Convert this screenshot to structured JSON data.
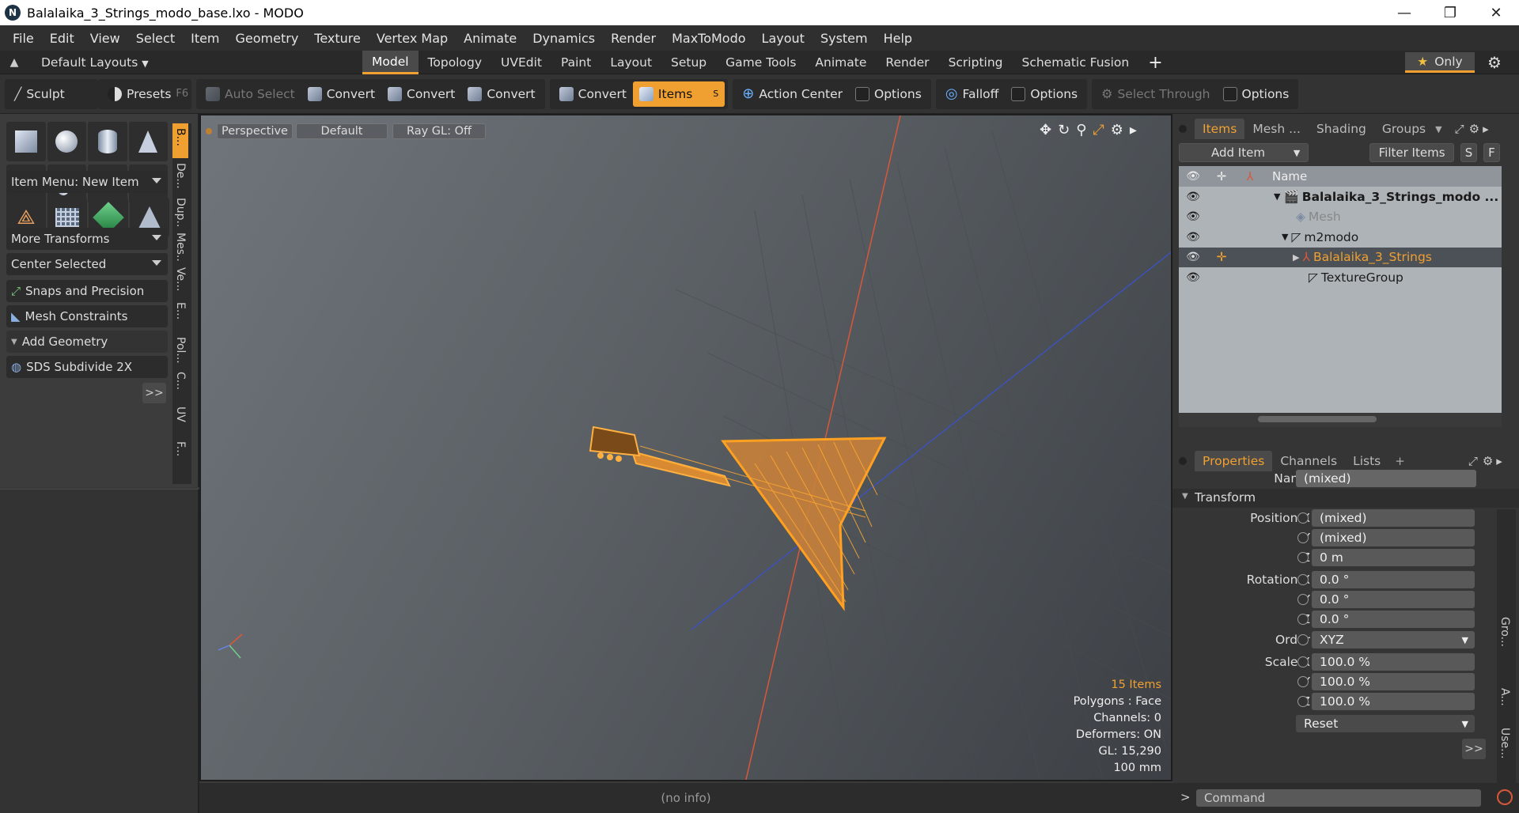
{
  "window": {
    "title": "Balalaika_3_Strings_modo_base.lxo - MODO",
    "logo": "N",
    "min": "—",
    "max": "❐",
    "close": "✕"
  },
  "menu": [
    "File",
    "Edit",
    "View",
    "Select",
    "Item",
    "Geometry",
    "Texture",
    "Vertex Map",
    "Animate",
    "Dynamics",
    "Render",
    "MaxToModo",
    "Layout",
    "System",
    "Help"
  ],
  "layoutbar": {
    "layouts_label": "Default Layouts",
    "tabs": [
      "Model",
      "Topology",
      "UVEdit",
      "Paint",
      "Layout",
      "Setup",
      "Game Tools",
      "Animate",
      "Render",
      "Scripting",
      "Schematic Fusion"
    ],
    "active_tab": "Model",
    "plus": "+",
    "only": "Only",
    "star": "★",
    "gear": "⚙"
  },
  "toolbar": {
    "sculpt": "Sculpt",
    "presets": "Presets",
    "presets_key": "F6",
    "auto_select": "Auto Select",
    "convert1": "Convert",
    "convert2": "Convert",
    "convert3": "Convert",
    "convert4": "Convert",
    "items": "Items",
    "items_key": "S",
    "action_center": "Action Center",
    "options1": "Options",
    "falloff": "Falloff",
    "options2": "Options",
    "select_through": "Select Through",
    "options3": "Options"
  },
  "leftpanel": {
    "item_menu": "Item Menu: New Item",
    "more_transforms": "More Transforms",
    "center_selected": "Center Selected",
    "snaps": "Snaps and Precision",
    "mesh_constraints": "Mesh Constraints",
    "add_geometry": "Add Geometry",
    "sds": "SDS Subdivide 2X",
    "more": ">>",
    "vtabs": [
      "B...",
      "De...",
      "Dup...",
      "Mes...",
      "Ve...",
      "E...",
      "Pol...",
      "C...",
      "UV",
      "F..."
    ]
  },
  "viewport": {
    "view": "Perspective",
    "shading": "Default",
    "raygl": "Ray GL: Off",
    "info": {
      "items": "15 Items",
      "polygons": "Polygons : Face",
      "channels": "Channels: 0",
      "deformers": "Deformers: ON",
      "gl": "GL: 15,290",
      "scale": "100 mm"
    },
    "accent": "#f0a030"
  },
  "status": {
    "text": "(no info)"
  },
  "items_panel": {
    "tabs": [
      "Items",
      "Mesh ...",
      "Shading",
      "Groups"
    ],
    "add_item": "Add Item",
    "filter_items": "Filter Items",
    "s_btn": "S",
    "f_btn": "F",
    "name_col": "Name",
    "rows": [
      {
        "name": "Balalaika_3_Strings_modo ...",
        "bold": true
      },
      {
        "name": "Mesh"
      },
      {
        "name": "m2modo"
      },
      {
        "name": "Balalaika_3_Strings",
        "selected": true
      },
      {
        "name": "TextureGroup"
      }
    ]
  },
  "properties": {
    "tabs": [
      "Properties",
      "Channels",
      "Lists"
    ],
    "plus": "+",
    "name_label": "Name",
    "name_value": "(mixed)",
    "transform": "Transform",
    "position_label": "Position X",
    "pos_x": "(mixed)",
    "pos_y": "(mixed)",
    "pos_z": "0 m",
    "rotation_label": "Rotation X",
    "rot_x": "0.0 °",
    "rot_y": "0.0 °",
    "rot_z": "0.0 °",
    "order_label": "Order",
    "order": "XYZ",
    "scale_label": "Scale X",
    "scale_x": "100.0 %",
    "scale_y": "100.0 %",
    "scale_z": "100.0 %",
    "y_label": "Y",
    "z_label": "Z",
    "reset": "Reset",
    "more": ">>",
    "side_tabs": [
      "Gro...",
      "A...",
      "Use..."
    ]
  },
  "command": {
    "prompt": ">",
    "placeholder": "Command"
  }
}
